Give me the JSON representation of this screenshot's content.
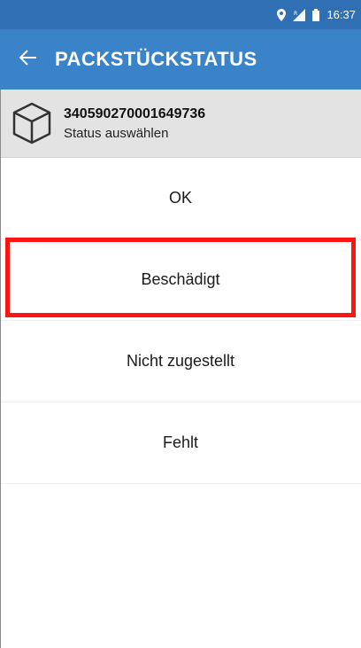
{
  "status_bar": {
    "time": "16:37",
    "icons": [
      "location-icon",
      "signal-icon",
      "battery-icon"
    ]
  },
  "app_bar": {
    "title": "PACKSTÜCKSTATUS",
    "back_icon": "arrow-left-icon"
  },
  "parcel": {
    "icon": "package-box-icon",
    "id": "340590270001649736",
    "subtitle": "Status auswählen"
  },
  "options": [
    {
      "label": "OK"
    },
    {
      "label": "Beschädigt",
      "highlighted": true
    },
    {
      "label": "Nicht zugestellt"
    },
    {
      "label": "Fehlt"
    }
  ],
  "colors": {
    "status_bar": "#2f6fb4",
    "app_bar": "#3b83c8",
    "header_bg": "#e3e3e3",
    "highlight": "#ff1414"
  }
}
